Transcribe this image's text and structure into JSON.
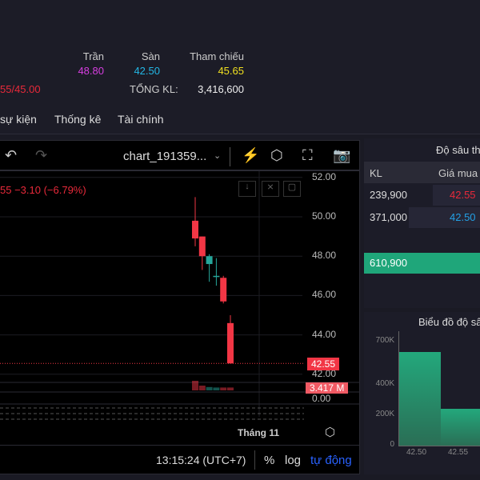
{
  "header": {
    "tran_label": "Trần",
    "tran_value": "48.80",
    "san_label": "Sàn",
    "san_value": "42.50",
    "thamchieu_label": "Tham chiếu",
    "thamchieu_value": "45.65",
    "range_partial": "55/45.00",
    "tongkl_label": "TỔNG KL:",
    "tongkl_value": "3,416,600"
  },
  "tabs": [
    {
      "label": "sự kiện"
    },
    {
      "label": "Thống kê"
    },
    {
      "label": "Tài chính"
    }
  ],
  "chart": {
    "name": "chart_191359...",
    "change": "55  −3.10 (−6.79%)",
    "price_ticks": [
      "52.00",
      "50.00",
      "48.00",
      "46.00",
      "44.00",
      "42.00"
    ],
    "last_price": "42.55",
    "volume_label": "3.417 M",
    "vol_zero": "0.00",
    "time_label": "Tháng 11",
    "clock": "13:15:24 (UTC+7)",
    "pct": "%",
    "log": "log",
    "auto": "tự động",
    "candles": [
      {
        "o": 49.8,
        "h": 51.0,
        "l": 48.5,
        "c": 48.9
      },
      {
        "o": 49.0,
        "h": 49.0,
        "l": 47.3,
        "c": 48.0
      },
      {
        "o": 47.6,
        "h": 48.1,
        "l": 46.7,
        "c": 48.0
      },
      {
        "o": 47.0,
        "h": 47.9,
        "l": 46.5,
        "c": 47.0
      },
      {
        "o": 46.9,
        "h": 47.0,
        "l": 45.6,
        "c": 45.7
      },
      {
        "o": 44.6,
        "h": 45.0,
        "l": 42.55,
        "c": 42.55
      }
    ],
    "volumes": [
      1.0,
      0.5,
      0.35,
      0.3,
      0.3,
      0.3
    ],
    "colors": {
      "up": "#26a69a",
      "down": "#f23645"
    }
  },
  "orderbook": {
    "title": "Độ sâu th",
    "col_kl": "KL",
    "col_gia": "Giá mua",
    "rows": [
      {
        "kl": "239,900",
        "price": "42.55"
      },
      {
        "kl": "371,000",
        "price": "42.50"
      }
    ],
    "total": "610,900"
  },
  "depth": {
    "title": "Biểu đồ độ sâ",
    "yticks": [
      "700K",
      "400K",
      "200K",
      "0"
    ],
    "xticks": [
      "42.50",
      "42.55"
    ]
  }
}
